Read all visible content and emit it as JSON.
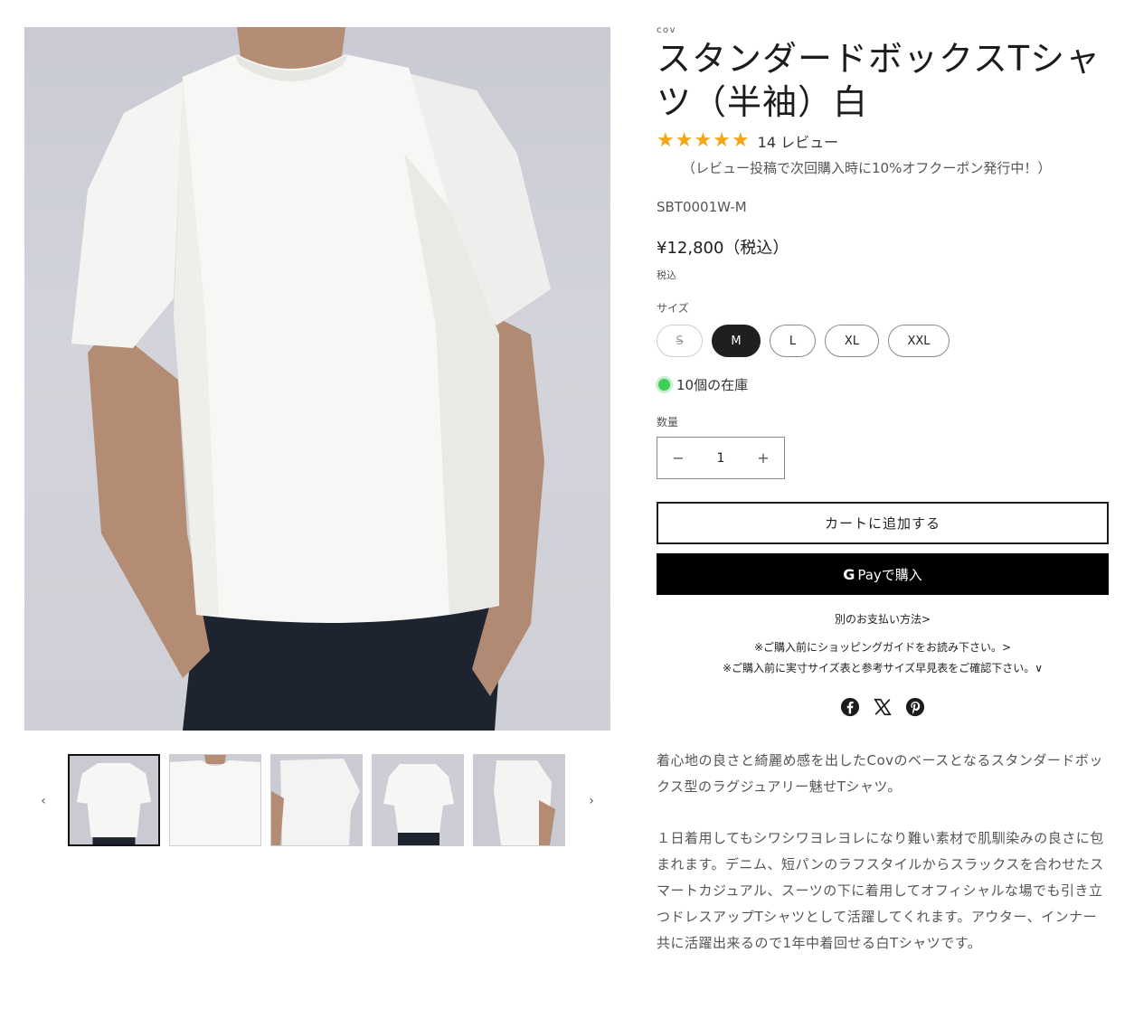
{
  "product": {
    "vendor": "cov",
    "title": "スタンダードボックスTシャツ（半袖）白",
    "rating_stars": 5,
    "review_count": "14 レビュー",
    "coupon_note": "（レビュー投稿で次回購入時に10%オフクーポン発行中！）",
    "sku": "SBT0001W-M",
    "price": "¥12,800（税込）",
    "tax_note": "税込",
    "size_label": "サイズ",
    "sizes": [
      {
        "label": "S",
        "state": "disabled"
      },
      {
        "label": "M",
        "state": "selected"
      },
      {
        "label": "L",
        "state": "available"
      },
      {
        "label": "XL",
        "state": "available"
      },
      {
        "label": "XXL",
        "state": "available"
      }
    ],
    "stock": "10個の在庫",
    "quantity_label": "数量",
    "quantity": "1",
    "quantity_minus": "−",
    "quantity_plus": "+",
    "add_to_cart": "カートに追加する",
    "gpay_g": "G",
    "gpay_label": "Payで購入",
    "more_payment": "別のお支払い方法>",
    "guide_link": "※ご購入前にショッピングガイドをお読み下さい。>",
    "size_chart_link": "※ご購入前に実寸サイズ表と参考サイズ早見表をご確認下さい。∨",
    "description": [
      "着心地の良さと綺麗め感を出したCovのベースとなるスタンダードボックス型のラグジュアリー魅せTシャツ。",
      "１日着用してもシワシワヨレヨレになり難い素材で肌馴染みの良さに包まれます。デニム、短パンのラフスタイルからスラックスを合わせたスマートカジュアル、スーツの下に着用してオフィシャルな場でも引き立つドレスアップTシャツとして活躍してくれます。アウター、インナー共に活躍出来るので1年中着回せる白Tシャツです。"
    ]
  },
  "gallery": {
    "prev_arrow": "‹",
    "next_arrow": "›",
    "thumbnails": 5
  },
  "colors": {
    "accent": "#1f1f1f",
    "star": "#f3a616",
    "stock_dot": "#3ecf57"
  },
  "icons": {
    "share": [
      "facebook-icon",
      "x-icon",
      "pinterest-icon"
    ]
  }
}
